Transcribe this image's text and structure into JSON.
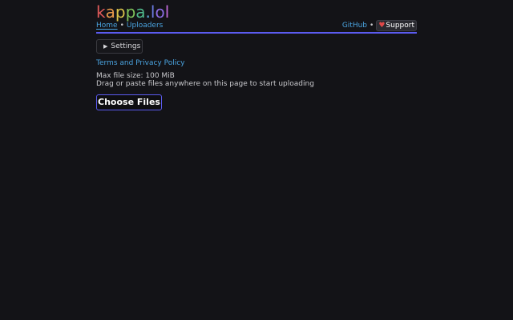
{
  "logo": {
    "letters": [
      "k",
      "a",
      "p",
      "p",
      "a",
      ".",
      "l",
      "o",
      "l"
    ],
    "colors": [
      "#e05a5a",
      "#e89a4a",
      "#d9c44a",
      "#7ec25a",
      "#4fb88a",
      "#5aaad8",
      "#6a7ae0",
      "#8a6ae0",
      "#c06ad8"
    ]
  },
  "nav": {
    "home": "Home",
    "separator": "•",
    "uploaders": "Uploaders",
    "github": "GitHub",
    "support": "Support",
    "support_icon": "heart-icon"
  },
  "colors": {
    "background": "#131317",
    "accent": "#5b5bf0",
    "link": "#4aa3df"
  },
  "settings": {
    "label": "Settings",
    "icon": "triangle-right-icon"
  },
  "terms_link": "Terms and Privacy Policy",
  "info": {
    "max_size": "Max file size: 100 MiB",
    "drag_hint": "Drag or paste files anywhere on this page to start uploading"
  },
  "choose_button": "Choose Files"
}
